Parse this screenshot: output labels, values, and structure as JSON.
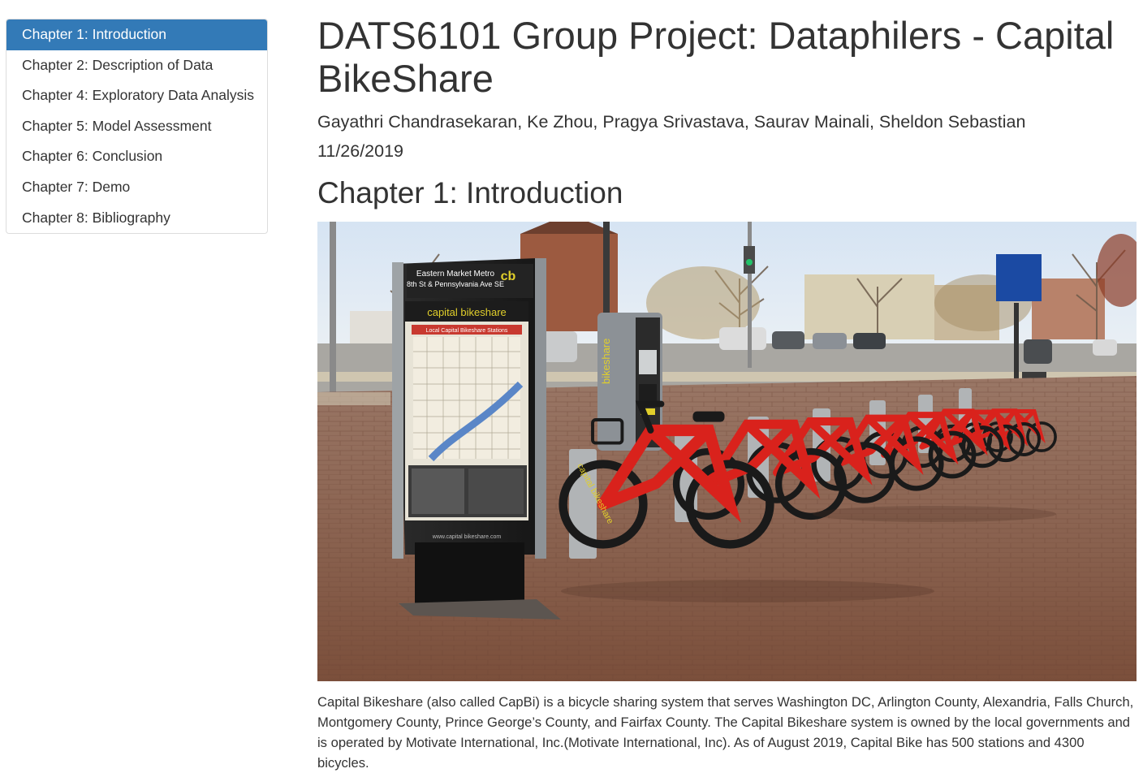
{
  "toc": {
    "items": [
      {
        "label": "Chapter 1: Introduction",
        "active": true
      },
      {
        "label": "Chapter 2: Description of Data"
      },
      {
        "label": "Chapter 4: Exploratory Data Analysis"
      },
      {
        "label": "Chapter 5: Model Assessment"
      },
      {
        "label": "Chapter 6: Conclusion"
      },
      {
        "label": "Chapter 7: Demo"
      },
      {
        "label": "Chapter 8: Bibliography"
      }
    ]
  },
  "header": {
    "title": "DATS6101 Group Project: Dataphilers - Capital BikeShare",
    "authors": "Gayathri Chandrasekaran, Ke Zhou, Pragya Srivastava, Saurav Mainali, Sheldon Sebastian",
    "date": "11/26/2019"
  },
  "chapter1": {
    "heading": "Chapter 1: Introduction",
    "photo": {
      "kiosk_station": "Eastern Market Metro",
      "kiosk_address": "8th St & Pennsylvania Ave SE",
      "kiosk_brand": "capital bikeshare",
      "kiosk_map_title": "Local Capital Bikeshare Stations",
      "kiosk_url": "www.capital bikeshare.com",
      "payment_brand": "bikeshare",
      "bike_brand": "capital bikeshare",
      "colors": {
        "bike_red": "#d9221c",
        "sky": "#dfe9f4",
        "pavement": "#8a5a43"
      }
    },
    "paragraph": "Capital Bikeshare (also called CapBi) is a bicycle sharing system that serves Washington DC, Arlington County, Alexandria, Falls Church, Montgomery County, Prince George’s County, and Fairfax County. The Capital Bikeshare system is owned by the local governments and is operated by Motivate International, Inc.(Motivate International, Inc). As of August 2019, Capital Bike has 500 stations and 4300 bicycles."
  }
}
